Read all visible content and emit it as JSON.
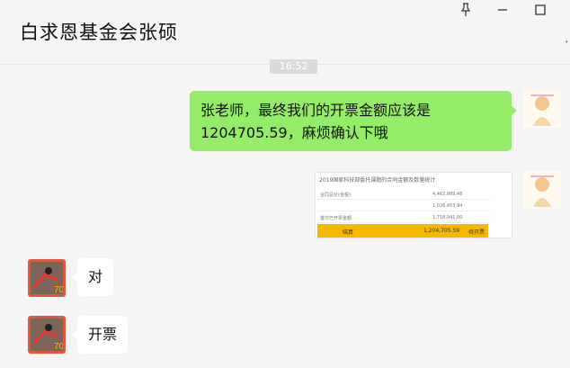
{
  "header": {
    "title": "白求恩基金会张硕"
  },
  "window_controls": {
    "pin_icon": "pin-icon",
    "minimize_icon": "minimize-icon",
    "maximize_icon": "maximize-icon"
  },
  "timestamp": "16:52",
  "messages": {
    "outgoing_text": "张老师，最终我们的开票金额应该是1204705.59，麻烦确认下哦",
    "image": {
      "title": "2019国家科技部委托课题的合同金额及数量统计",
      "rows": [
        {
          "label": "合同总价(含税)",
          "value": "4,462,989.48"
        },
        {
          "label": "",
          "value": "1,026,453.94"
        },
        {
          "label": "首付已开票金额",
          "value": "1,718,941.00"
        }
      ],
      "highlight": {
        "label": "结算",
        "value": "1,204,705.59",
        "note": "待开票"
      }
    },
    "reply_1": "对",
    "reply_2": "开票"
  },
  "colors": {
    "outgoing_bubble": "#95ec69",
    "incoming_bubble": "#ffffff",
    "highlight_row": "#f6b800",
    "avatar_border": "#e0573f"
  }
}
